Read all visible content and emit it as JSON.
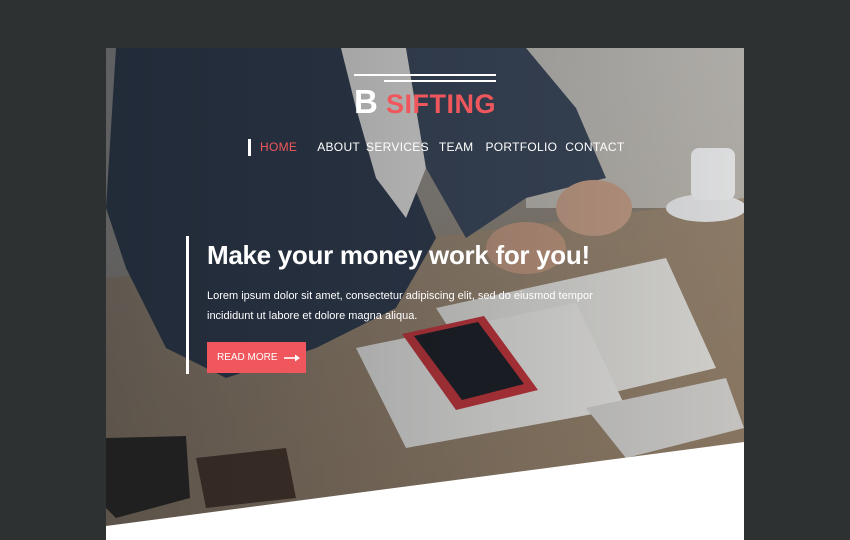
{
  "logo": {
    "letter": "B",
    "word": "SIFTING"
  },
  "nav": {
    "items": [
      {
        "label": "HOME"
      },
      {
        "label": "ABOUT"
      },
      {
        "label": "SERVICES"
      },
      {
        "label": "TEAM"
      },
      {
        "label": "PORTFOLIO"
      },
      {
        "label": "CONTACT"
      }
    ],
    "active": "HOME"
  },
  "hero": {
    "headline": "Make your money work for you!",
    "body": "Lorem ipsum dolor sit amet, consectetur adipiscing elit, sed do eiusmod tempor incididunt ut labore et dolore magna aliqua.",
    "cta_label": "READ MORE",
    "cta_icon": "arrow-right-icon"
  },
  "colors": {
    "accent": "#f0575c",
    "page_background": "#2d3132",
    "text_light": "#ffffff"
  }
}
